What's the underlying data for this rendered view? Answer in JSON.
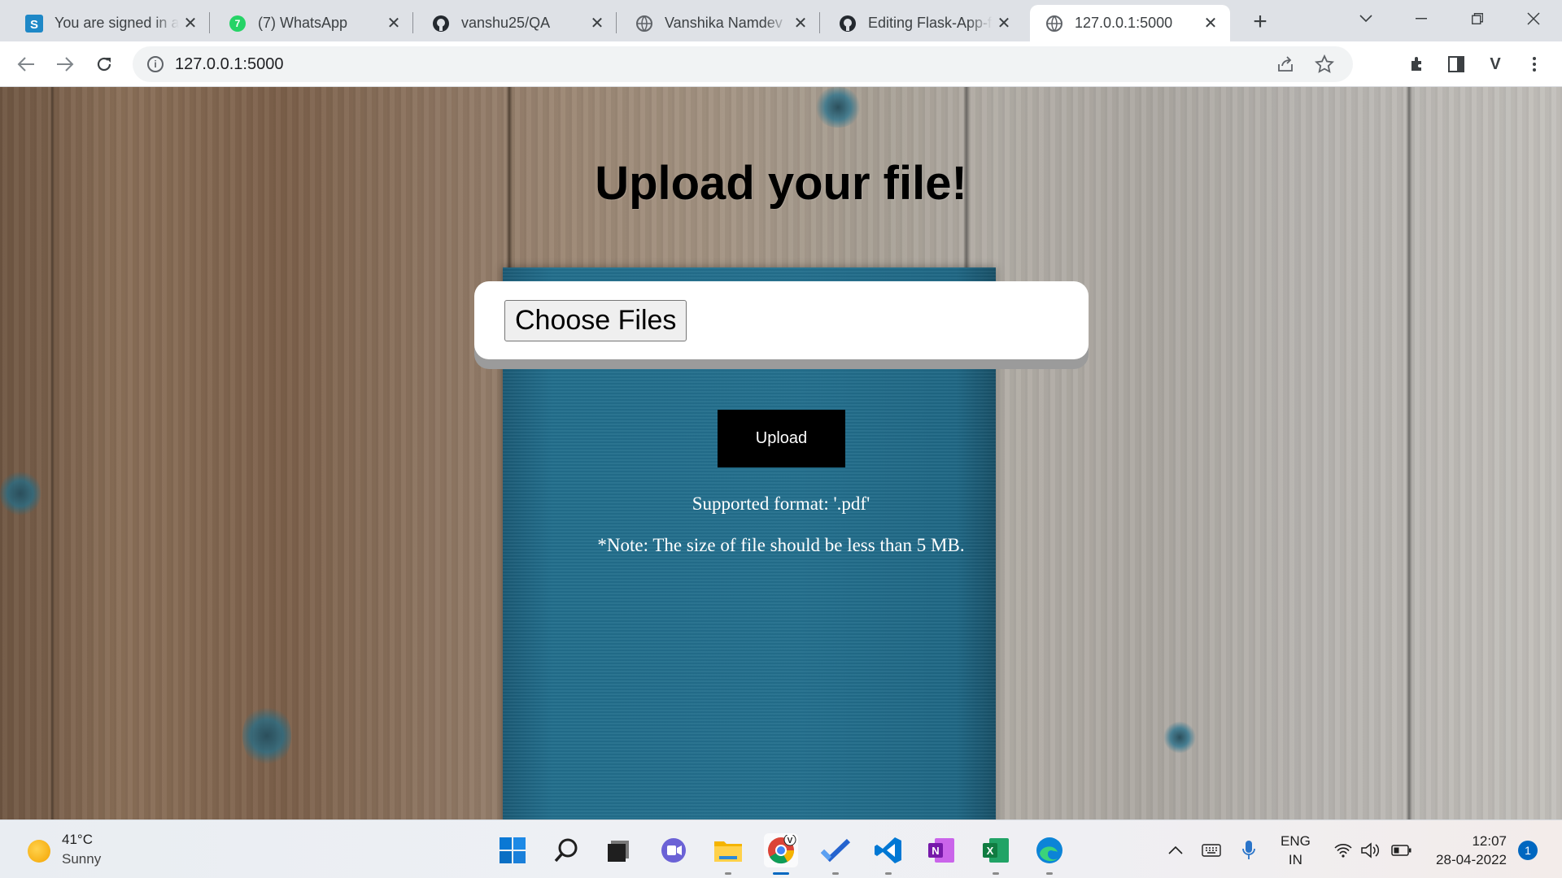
{
  "browser": {
    "tabs": [
      {
        "title": "You are signed in as",
        "icon": "simplenote-icon",
        "active": false
      },
      {
        "title": "(7) WhatsApp",
        "icon": "whatsapp-icon",
        "active": false
      },
      {
        "title": "vanshu25/QA",
        "icon": "github-icon",
        "active": false
      },
      {
        "title": "Vanshika Namdev",
        "icon": "globe-icon",
        "active": false
      },
      {
        "title": "Editing Flask-App-f",
        "icon": "github-icon",
        "active": false
      },
      {
        "title": "127.0.0.1:5000",
        "icon": "globe-icon",
        "active": true
      }
    ],
    "address": "127.0.0.1:5000",
    "profile_initial": "V"
  },
  "page": {
    "heading": "Upload your file!",
    "choose_files_label": "Choose Files",
    "upload_label": "Upload",
    "supported_format": "Supported format: '.pdf'",
    "note": "*Note: The size of file should be less than 5 MB."
  },
  "taskbar": {
    "weather": {
      "temp": "41°C",
      "condition": "Sunny"
    },
    "apps": [
      "start-icon",
      "search-icon",
      "task-view-icon",
      "teams-chat-icon",
      "file-explorer-icon",
      "chrome-icon",
      "todo-icon",
      "vscode-icon",
      "onenote-icon",
      "excel-icon",
      "edge-icon"
    ],
    "language": {
      "line1": "ENG",
      "line2": "IN"
    },
    "clock": {
      "time": "12:07",
      "date": "28-04-2022"
    },
    "notifications": "1"
  },
  "colors": {
    "accent": "#0067c0",
    "upload_button": "#000000",
    "book": "#226e8c"
  }
}
